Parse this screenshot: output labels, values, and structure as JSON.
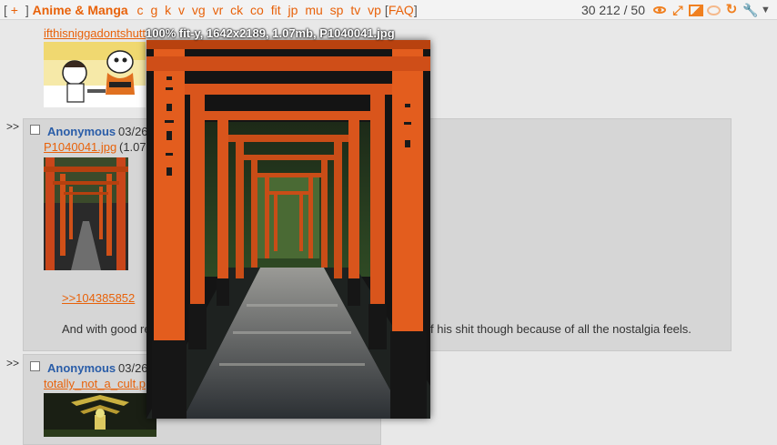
{
  "topbar": {
    "open_bracket": "[",
    "plus": "+",
    "close_bracket": "]",
    "board_title": "Anime & Manga",
    "boards": [
      "c",
      "g",
      "k",
      "v",
      "vg",
      "vr",
      "ck",
      "co",
      "fit",
      "jp",
      "mu",
      "sp",
      "tv",
      "vp"
    ],
    "faq_open": "[",
    "faq": "FAQ",
    "faq_close": "]",
    "counter": "30 212 / 50",
    "icons": [
      "eye-icon",
      "expand-icon",
      "image-icon",
      "bubble-icon",
      "refresh-icon",
      "wrench-icon",
      "chevron-down-icon"
    ]
  },
  "posts": [
    {
      "file_link": "ifthisniggadontshutt"
    },
    {
      "arrow": ">>",
      "name": "Anonymous",
      "date": "03/26",
      "file_link": "P1040041.jpg",
      "file_info": "(1.07",
      "quote": ">>104385852",
      "message_start": "And with good re",
      "message_end": "f his shit though because of all the nostalgia feels."
    },
    {
      "arrow": ">>",
      "name": "Anonymous",
      "date": "03/26",
      "file_link": "totally_not_a_cult.p"
    }
  ],
  "hover_preview": {
    "info": "100% fit-y, 1642x2189, 1.07mb, P1040041.jpg"
  },
  "colors": {
    "accent": "#e8620a",
    "name": "#2a5da8",
    "torii": "#d9551c",
    "background": "#e8e8e8"
  }
}
